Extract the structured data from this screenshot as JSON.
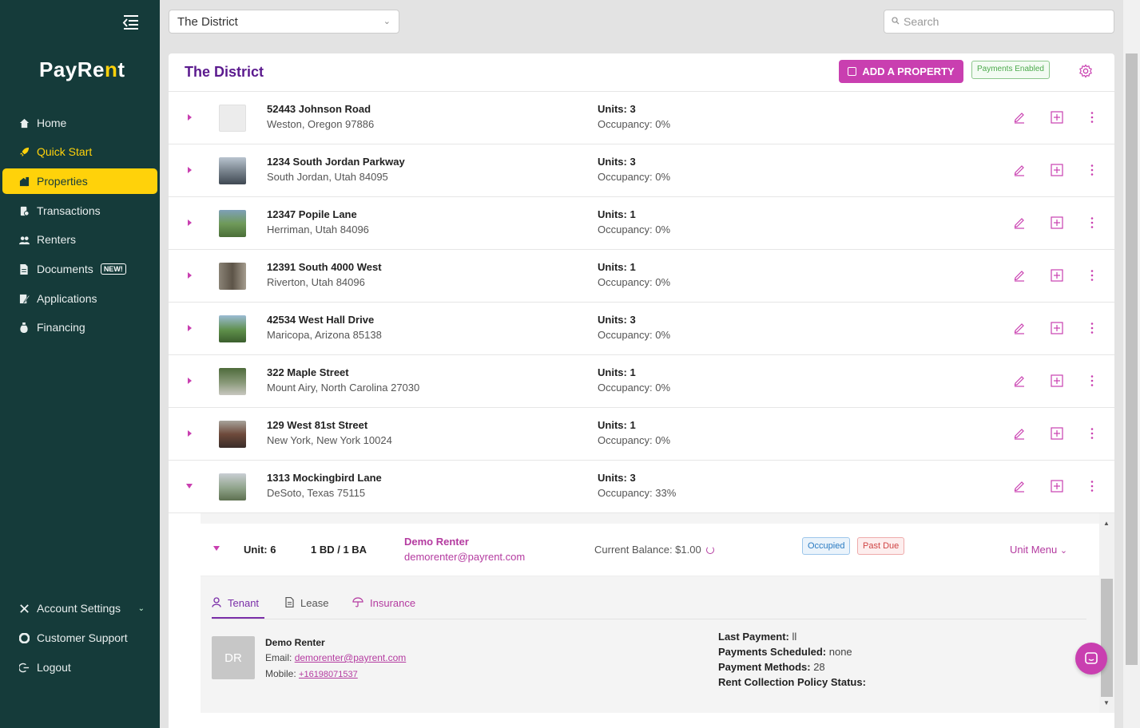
{
  "app": {
    "logo_pre": "PayRe",
    "logo_accent": "n",
    "logo_post": "t"
  },
  "sidebar": {
    "items": [
      {
        "label": "Home",
        "icon": "home-icon"
      },
      {
        "label": "Quick Start",
        "icon": "rocket-icon"
      },
      {
        "label": "Properties",
        "icon": "properties-icon"
      },
      {
        "label": "Transactions",
        "icon": "transactions-icon"
      },
      {
        "label": "Renters",
        "icon": "users-icon"
      },
      {
        "label": "Documents",
        "icon": "document-icon",
        "badge": "NEW!"
      },
      {
        "label": "Applications",
        "icon": "applications-icon"
      },
      {
        "label": "Financing",
        "icon": "financing-icon"
      }
    ],
    "bottom": [
      {
        "label": "Account Settings",
        "icon": "tools-icon"
      },
      {
        "label": "Customer Support",
        "icon": "support-icon"
      },
      {
        "label": "Logout",
        "icon": "logout-icon"
      }
    ]
  },
  "topbar": {
    "selected_property": "The District",
    "search_placeholder": "Search"
  },
  "card": {
    "title": "The District",
    "add_label": "ADD A PROPERTY",
    "payments_badge": "Payments Enabled"
  },
  "properties": [
    {
      "address": "52443 Johnson Road",
      "city": "Weston, Oregon 97886",
      "units": "Units: 3",
      "occupancy": "Occupancy: 0%"
    },
    {
      "address": "1234 South Jordan Parkway",
      "city": "South Jordan, Utah 84095",
      "units": "Units: 3",
      "occupancy": "Occupancy: 0%"
    },
    {
      "address": "12347 Popile Lane",
      "city": "Herriman, Utah 84096",
      "units": "Units: 1",
      "occupancy": "Occupancy: 0%"
    },
    {
      "address": "12391 South 4000 West",
      "city": "Riverton, Utah 84096",
      "units": "Units: 1",
      "occupancy": "Occupancy: 0%"
    },
    {
      "address": "42534 West Hall Drive",
      "city": "Maricopa, Arizona 85138",
      "units": "Units: 3",
      "occupancy": "Occupancy: 0%"
    },
    {
      "address": "322 Maple Street",
      "city": "Mount Airy, North Carolina 27030",
      "units": "Units: 1",
      "occupancy": "Occupancy: 0%"
    },
    {
      "address": "129 West 81st Street",
      "city": "New York, New York 10024",
      "units": "Units: 1",
      "occupancy": "Occupancy: 0%"
    },
    {
      "address": "1313 Mockingbird Lane",
      "city": "DeSoto, Texas 75115",
      "units": "Units: 3",
      "occupancy": "Occupancy: 33%"
    }
  ],
  "unit": {
    "unit_label": "Unit: 6",
    "bd_ba": "1 BD / 1 BA",
    "renter_name": "Demo Renter",
    "renter_email": "demorenter@payrent.com",
    "balance": "Current Balance: $1.00",
    "status_occupied": "Occupied",
    "status_due": "Past Due",
    "menu_label": "Unit Menu"
  },
  "tabs": {
    "tenant": "Tenant",
    "lease": "Lease",
    "insurance": "Insurance"
  },
  "tenant": {
    "initials": "DR",
    "name": "Demo Renter",
    "email_label": "Email:",
    "email": "demorenter@payrent.com",
    "mobile_label": "Mobile:",
    "mobile": "+16198071537",
    "last_payment_label": "Last Payment:",
    "last_payment": "ll",
    "scheduled_label": "Payments Scheduled:",
    "scheduled": "none",
    "methods_label": "Payment Methods:",
    "methods": "28",
    "policy_label": "Rent Collection Policy Status:"
  },
  "colors": {
    "sidebar": "#153b3a",
    "accent_yellow": "#ffd20a",
    "brand_pink": "#c93fb0",
    "title_purple": "#5b1a8e"
  }
}
